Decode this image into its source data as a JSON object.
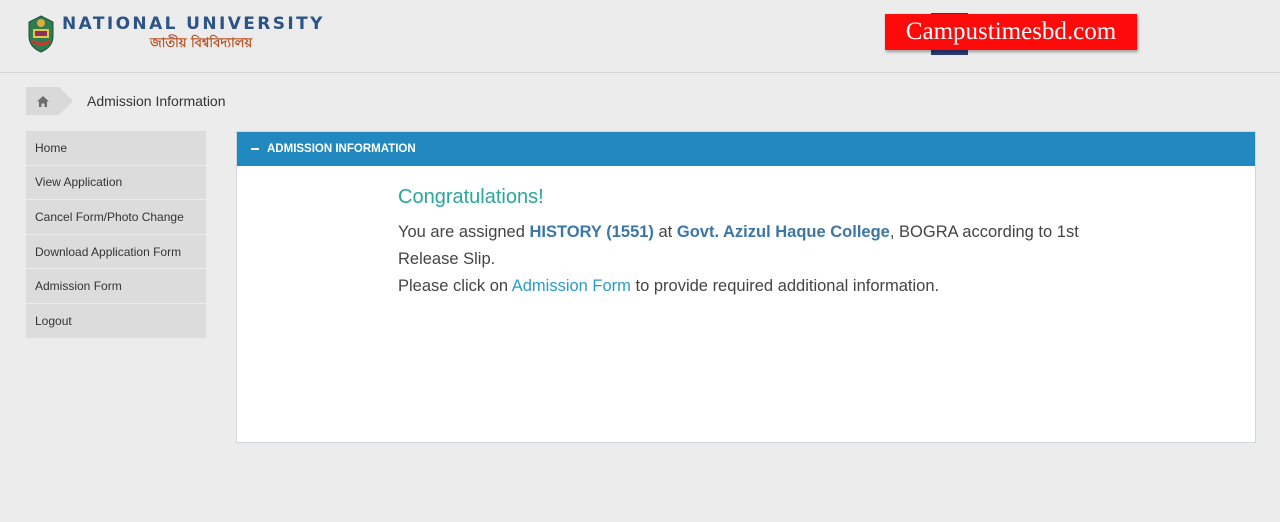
{
  "header": {
    "logo_en": "NATIONAL UNIVERSITY",
    "logo_bn": "জাতীয় বিশ্ববিদ্যালয়",
    "watermark": "Campustimesbd.com"
  },
  "breadcrumb": {
    "current": "Admission Information"
  },
  "sidebar": {
    "items": [
      {
        "label": "Home"
      },
      {
        "label": "View Application"
      },
      {
        "label": "Cancel Form/Photo Change"
      },
      {
        "label": "Download Application Form"
      },
      {
        "label": "Admission Form"
      },
      {
        "label": "Logout"
      }
    ]
  },
  "panel": {
    "title": "ADMISSION INFORMATION",
    "congrats": "Congratulations!",
    "line1_prefix": "You are assigned ",
    "subject": "HISTORY (1551)",
    "line1_mid": " at ",
    "college": "Govt. Azizul Haque College",
    "line1_suffix": ", BOGRA according to 1st Release Slip.",
    "line2_prefix": "Please click on ",
    "link_text": "Admission Form",
    "line2_suffix": " to provide required additional information."
  },
  "colors": {
    "panel_header": "#2189bf",
    "congrats": "#2aa79b",
    "highlight": "#3b76a6",
    "watermark_bg": "#ff0a0a"
  }
}
